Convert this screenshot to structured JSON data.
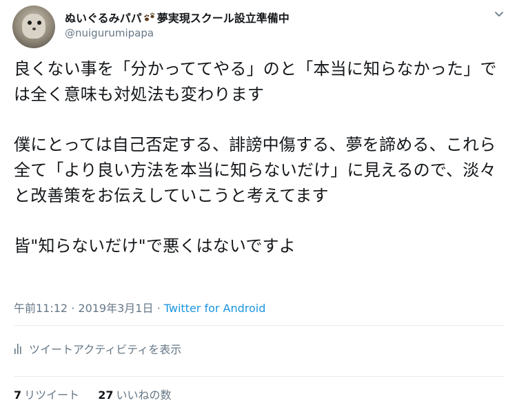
{
  "author": {
    "display_name": "ぬいぐるみパパ",
    "display_name_suffix": "夢実現スクール設立準備中",
    "handle": "@nuigurumipapa",
    "avatar_icon": "plush-toy-avatar",
    "emoji_icon": "paw-prints-icon"
  },
  "tweet": {
    "paragraphs": [
      "良くない事を「分かっててやる」のと「本当に知らなかった」では全く意味も対処法も変わります",
      "僕にとっては自己否定する、誹謗中傷する、夢を諦める、これら全て「より良い方法を本当に知らないだけ」に見えるので、淡々と改善策をお伝えしていこうと考えてます",
      "皆\"知らないだけ\"で悪くはないですよ"
    ]
  },
  "meta": {
    "time": "午前11:12",
    "separator": " · ",
    "date": "2019年3月1日",
    "source": "Twitter for Android"
  },
  "activity": {
    "label": "ツイートアクティビティを表示",
    "icon": "bar-chart-icon"
  },
  "stats": {
    "retweets_count": "7",
    "retweets_label": "リツイート",
    "likes_count": "27",
    "likes_label": "いいねの数"
  },
  "colors": {
    "text": "#14171a",
    "secondary": "#657786",
    "link": "#1b95e0",
    "divider": "#e6ecf0"
  }
}
